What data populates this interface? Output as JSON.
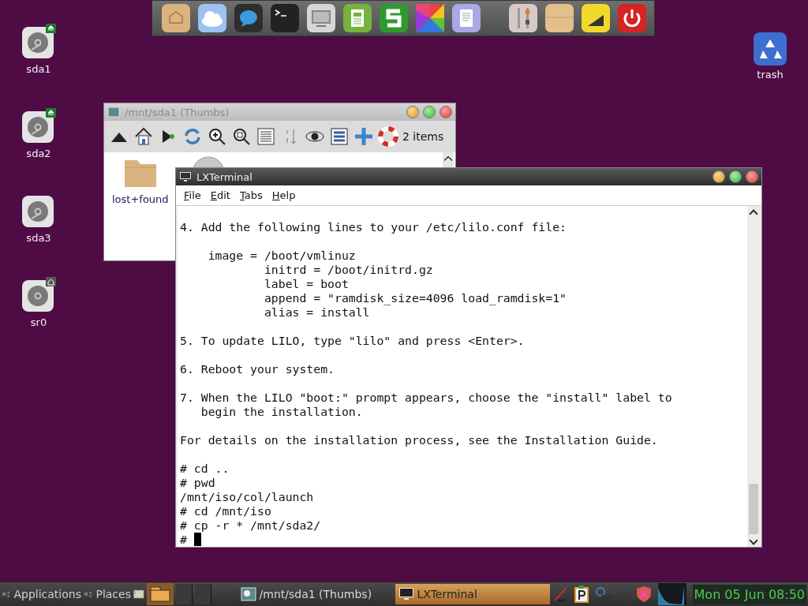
{
  "desktop_icons": [
    {
      "label": "sda1",
      "kind": "disk",
      "mounted": true,
      "home": false
    },
    {
      "label": "sda2",
      "kind": "disk",
      "mounted": true,
      "home": false
    },
    {
      "label": "sda3",
      "kind": "disk",
      "mounted": false,
      "home": false
    },
    {
      "label": "sr0",
      "kind": "optical",
      "mounted": false,
      "home": true
    }
  ],
  "trash": {
    "label": "trash"
  },
  "file_manager": {
    "title": "/mnt/sda1 (Thumbs)",
    "active": false,
    "status": "2 items",
    "items": [
      {
        "kind": "folder",
        "label": "lost+found"
      },
      {
        "kind": "disc"
      }
    ]
  },
  "terminal": {
    "title": "LXTerminal",
    "active": true,
    "menu": [
      "File",
      "Edit",
      "Tabs",
      "Help"
    ],
    "blocks": [
      [
        "4. Add the following lines to your /etc/lilo.conf file:"
      ],
      [
        "    image = /boot/vmlinuz",
        "            initrd = /boot/initrd.gz",
        "            label = boot",
        "            append = \"ramdisk_size=4096 load_ramdisk=1\"",
        "            alias = install"
      ],
      [
        "5. To update LILO, type \"lilo\" and press <Enter>."
      ],
      [
        "6. Reboot your system."
      ],
      [
        "7. When the LILO \"boot:\" prompt appears, choose the \"install\" label to",
        "   begin the installation."
      ],
      [
        "For details on the installation process, see the Installation Guide."
      ],
      [
        "# cd ..",
        "# pwd",
        "/mnt/iso/col/launch",
        "# cd /mnt/iso",
        "# cp -r * /mnt/sda2/"
      ]
    ],
    "prompt": "#"
  },
  "taskbar": {
    "menus": [
      "Applications",
      "Places"
    ],
    "tasks": [
      {
        "label": "/mnt/sda1 (Thumbs)",
        "kind": "files",
        "selected": false
      },
      {
        "label": "LXTerminal",
        "kind": "terminal",
        "selected": true
      }
    ],
    "clock": "Mon 05 Jun 08:50"
  }
}
